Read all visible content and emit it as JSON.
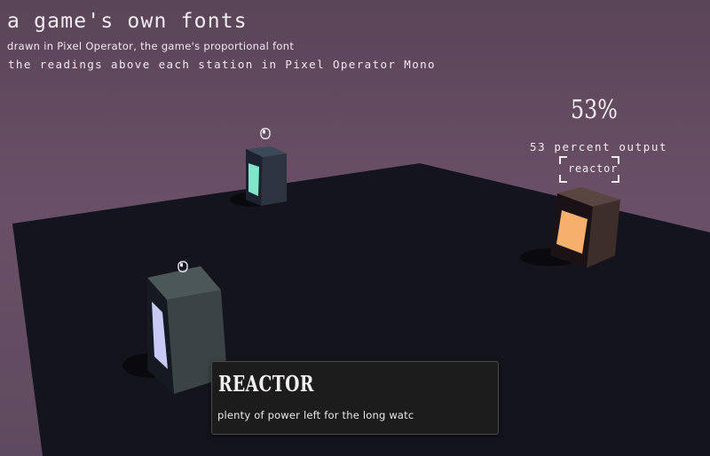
{
  "title": "a game's own fonts",
  "subtitle_proportional": "drawn in Pixel Operator, the game's proportional font",
  "subtitle_mono": "the readings above each station in Pixel Operator Mono",
  "stations": [
    {
      "name": "station-near",
      "screen_color": "#c8caf5",
      "body_color": "#3a4444",
      "icon": "mouse-icon"
    },
    {
      "name": "station-far",
      "screen_color": "#7fe6c8",
      "body_color": "#2c3440",
      "icon": "mouse-icon"
    },
    {
      "name": "reactor",
      "screen_color": "#f6b06e",
      "body_color": "#3e2e2a",
      "icon": "none"
    }
  ],
  "reactor_reading": {
    "percent_label": "53%",
    "output_label": "53 percent output",
    "target_label": "reactor",
    "output_percent": 53
  },
  "info_panel": {
    "title": "REACTOR",
    "body": "plenty of power left for the long watc"
  },
  "colors": {
    "sky": "#5f4a5e",
    "floor": "#14141f",
    "panel_bg": "#1c1c1d"
  }
}
